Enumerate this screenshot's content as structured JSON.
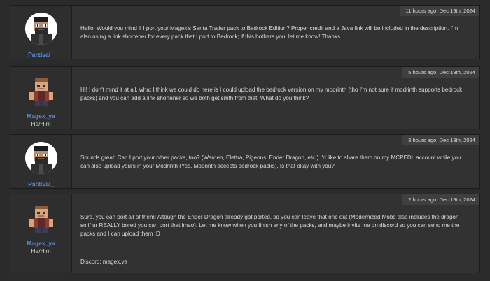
{
  "posts": [
    {
      "username": "Parzival_",
      "pronouns": "",
      "avatar": "parzival-avatar",
      "timestamp": "11 hours ago, Dec 19th, 2024",
      "text": "Hello! Would you mind if I port your Magex's Santa Trader pack to Bedrock Edition? Proper credit and a Java link will be included in the description. I'm also using a link shortener for every pack that I port to Bedrock; if this bothers you, let me know! Thanks.",
      "signature": ""
    },
    {
      "username": "Magex_ya",
      "pronouns": "He/Him",
      "avatar": "magex-avatar",
      "timestamp": "5 hours ago, Dec 19th, 2024",
      "text": "Hi! I don't mind it at all, what I think we could do here is I could upload the bedrock version on my modrinth (tho I'm not sure if modrinth supports bedrock packs) and you can add a link shortener so we both get smth from that. What do you think?",
      "signature": ""
    },
    {
      "username": "Parzival_",
      "pronouns": "",
      "avatar": "parzival-avatar",
      "timestamp": "3 hours ago, Dec 19th, 2024",
      "text": "Sounds great! Can I port your other packs, too? (Warden, Elettra, Pigeons, Ender Dragon, etc.) I'd like to share them on my MCPEDL account while you can also upload yours in your Modrinth (Yes, Modrinth accepts bedrock packs). Is that okay with you?",
      "signature": ""
    },
    {
      "username": "Magex_ya",
      "pronouns": "He/Him",
      "avatar": "magex-avatar",
      "timestamp": "2 hours ago, Dec 19th, 2024",
      "text": "Sure, you can port all of them! Altough the Ender Dragon already got ported, so you can leave that one out (Modernized Mobs also includes the dragon so if ur REALLY bored you can port that lmao). Let me know when you finish any of the packs, and maybe invite me on discord so you can send me the packs and I can upload them ;D",
      "signature": "Discord: magex.ya"
    }
  ],
  "colors": {
    "background": "#2b2b2b",
    "post": "#323232",
    "username": "#5e8ee0",
    "timestamp_bg": "#3f3f3f"
  }
}
